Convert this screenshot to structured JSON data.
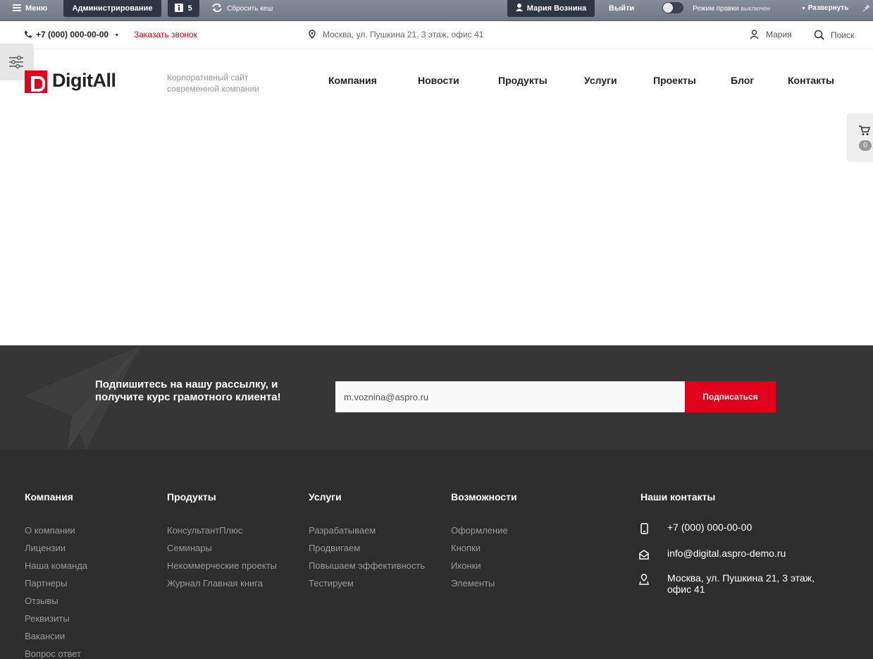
{
  "admin_bar": {
    "menu_label": "Меню",
    "admin_label": "Администрирование",
    "notifications_count": "5",
    "clear_cache_label": "Сбросить кеш",
    "user_name": "Мария Вознина",
    "logout_label": "Выйти",
    "edit_mode_label": "Режим правки",
    "edit_mode_state": "выключен",
    "expand_label": "Развернуть"
  },
  "top_row": {
    "phone": "+7 (000) 000-00-00",
    "callback_label": "Заказать звонок",
    "address": "Москва, ул. Пушкина 21, 3 этаж, офис 41",
    "user_label": "Мария",
    "search_label": "Поиск"
  },
  "header": {
    "logo_text": "DigitAll",
    "tagline": "Корпоративный сайт современной компании",
    "nav": [
      "Компания",
      "Новости",
      "Продукты",
      "Услуги",
      "Проекты",
      "Блог",
      "Контакты"
    ]
  },
  "cart": {
    "count": "0"
  },
  "subscribe": {
    "text": "Подпишитесь на нашу рассылку, и получите курс грамотного клиента!",
    "email_value": "m.voznina@aspro.ru",
    "button_label": "Подписаться"
  },
  "footer": {
    "columns": [
      {
        "title": "Компания",
        "links": [
          "О компании",
          "Лицензии",
          "Наша команда",
          "Партнеры",
          "Отзывы",
          "Реквизиты",
          "Вакансии",
          "Вопрос ответ"
        ]
      },
      {
        "title": "Продукты",
        "links": [
          "КонсультантПлюс",
          "Семинары",
          "Некоммерческие проекты",
          "Журнал Главная книга"
        ]
      },
      {
        "title": "Услуги",
        "links": [
          "Разрабатываем",
          "Продвигаем",
          "Повышаем эффективность",
          "Тестируем"
        ]
      },
      {
        "title": "Возможности",
        "links": [
          "Оформление",
          "Кнопки",
          "Иконки",
          "Элементы"
        ]
      }
    ],
    "contacts_title": "Наши контакты",
    "contacts": {
      "phone": "+7 (000) 000-00-00",
      "email": "info@digital.aspro-demo.ru",
      "address": "Москва, ул. Пушкина 21, 3 этаж, офис 41"
    }
  },
  "colors": {
    "accent": "#e2001a",
    "admin_bar": "#7a838e",
    "footer_bg": "#2d2d2d",
    "subscribe_bg": "#363636"
  }
}
